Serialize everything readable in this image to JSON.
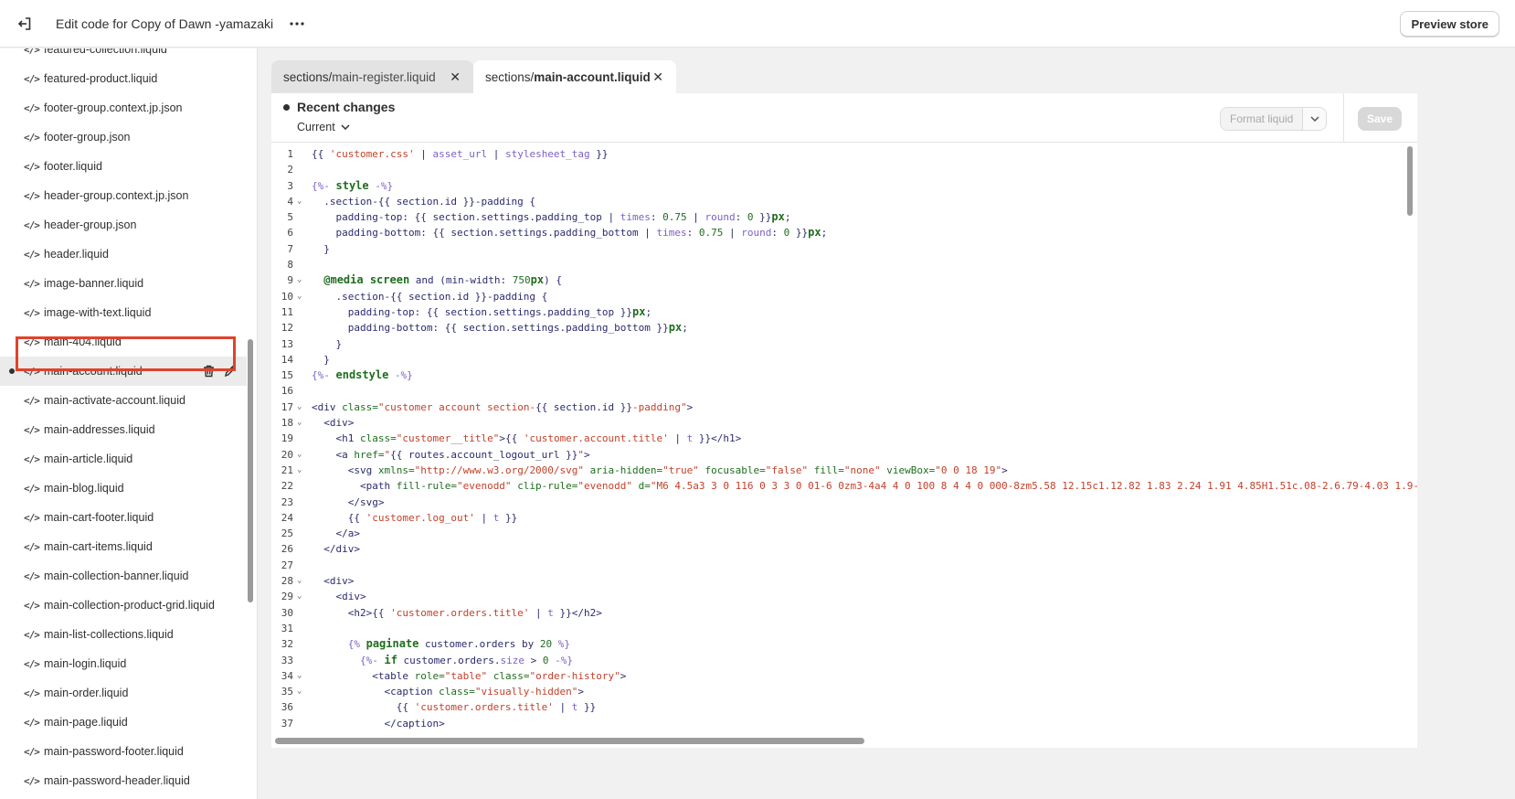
{
  "topbar": {
    "title": "Edit code for Copy of Dawn -yamazaki",
    "preview_label": "Preview store"
  },
  "sidebar": {
    "files": [
      {
        "name": "featured-collection.liquid"
      },
      {
        "name": "featured-product.liquid"
      },
      {
        "name": "footer-group.context.jp.json"
      },
      {
        "name": "footer-group.json"
      },
      {
        "name": "footer.liquid"
      },
      {
        "name": "header-group.context.jp.json"
      },
      {
        "name": "header-group.json"
      },
      {
        "name": "header.liquid"
      },
      {
        "name": "image-banner.liquid"
      },
      {
        "name": "image-with-text.liquid"
      },
      {
        "name": "main-404.liquid"
      },
      {
        "name": "main-account.liquid",
        "active": true,
        "modified": true
      },
      {
        "name": "main-activate-account.liquid"
      },
      {
        "name": "main-addresses.liquid"
      },
      {
        "name": "main-article.liquid"
      },
      {
        "name": "main-blog.liquid"
      },
      {
        "name": "main-cart-footer.liquid"
      },
      {
        "name": "main-cart-items.liquid"
      },
      {
        "name": "main-collection-banner.liquid"
      },
      {
        "name": "main-collection-product-grid.liquid"
      },
      {
        "name": "main-list-collections.liquid"
      },
      {
        "name": "main-login.liquid"
      },
      {
        "name": "main-order.liquid"
      },
      {
        "name": "main-page.liquid"
      },
      {
        "name": "main-password-footer.liquid"
      },
      {
        "name": "main-password-header.liquid"
      }
    ],
    "code_glyph": "</>"
  },
  "tabs": [
    {
      "dir": "sections/",
      "file": "main-register.liquid",
      "active": false
    },
    {
      "dir": "sections/",
      "file": "main-account.liquid",
      "active": true
    }
  ],
  "editor": {
    "recent_changes": "Recent changes",
    "version_select": "Current",
    "format_label": "Format liquid",
    "save_label": "Save",
    "lines": [
      {
        "n": "1",
        "fold": false,
        "tokens": [
          [
            "{{ ",
            "p"
          ],
          [
            "'customer.css'",
            "s"
          ],
          [
            " | ",
            "p"
          ],
          [
            "asset_url",
            "f"
          ],
          [
            " | ",
            "p"
          ],
          [
            "stylesheet_tag",
            "f"
          ],
          [
            " }}",
            "p"
          ]
        ]
      },
      {
        "n": "2",
        "fold": false,
        "tokens": []
      },
      {
        "n": "3",
        "fold": false,
        "tokens": [
          [
            "{%- ",
            "b"
          ],
          [
            "style",
            "k"
          ],
          [
            " -%}",
            "b"
          ]
        ]
      },
      {
        "n": "4",
        "fold": true,
        "tokens": [
          [
            "  .section-{{ ",
            "p"
          ],
          [
            "section.id",
            "p"
          ],
          [
            " }}-padding {",
            "p"
          ]
        ]
      },
      {
        "n": "5",
        "fold": false,
        "tokens": [
          [
            "    padding-top: {{ section.settings.padding_top | ",
            "p"
          ],
          [
            "times",
            "f"
          ],
          [
            ": ",
            "p"
          ],
          [
            "0.75",
            "n"
          ],
          [
            " | ",
            "p"
          ],
          [
            "round",
            "f"
          ],
          [
            ": ",
            "p"
          ],
          [
            "0",
            "n"
          ],
          [
            " }}",
            "p"
          ],
          [
            "px",
            "k"
          ],
          [
            ";",
            "p"
          ]
        ]
      },
      {
        "n": "6",
        "fold": false,
        "tokens": [
          [
            "    padding-bottom: {{ section.settings.padding_bottom | ",
            "p"
          ],
          [
            "times",
            "f"
          ],
          [
            ": ",
            "p"
          ],
          [
            "0.75",
            "n"
          ],
          [
            " | ",
            "p"
          ],
          [
            "round",
            "f"
          ],
          [
            ": ",
            "p"
          ],
          [
            "0",
            "n"
          ],
          [
            " }}",
            "p"
          ],
          [
            "px",
            "k"
          ],
          [
            ";",
            "p"
          ]
        ]
      },
      {
        "n": "7",
        "fold": false,
        "tokens": [
          [
            "  }",
            "p"
          ]
        ]
      },
      {
        "n": "8",
        "fold": false,
        "tokens": []
      },
      {
        "n": "9",
        "fold": true,
        "tokens": [
          [
            "  ",
            "p"
          ],
          [
            "@media screen",
            "k"
          ],
          [
            " and (min-width: ",
            "p"
          ],
          [
            "750",
            "n"
          ],
          [
            "px",
            "k"
          ],
          [
            ") {",
            "p"
          ]
        ]
      },
      {
        "n": "10",
        "fold": true,
        "tokens": [
          [
            "    .section-{{ section.id }}-padding {",
            "p"
          ]
        ]
      },
      {
        "n": "11",
        "fold": false,
        "tokens": [
          [
            "      padding-top: {{ section.settings.padding_top }}",
            "p"
          ],
          [
            "px",
            "k"
          ],
          [
            ";",
            "p"
          ]
        ]
      },
      {
        "n": "12",
        "fold": false,
        "tokens": [
          [
            "      padding-bottom: {{ section.settings.padding_bottom }}",
            "p"
          ],
          [
            "px",
            "k"
          ],
          [
            ";",
            "p"
          ]
        ]
      },
      {
        "n": "13",
        "fold": false,
        "tokens": [
          [
            "    }",
            "p"
          ]
        ]
      },
      {
        "n": "14",
        "fold": false,
        "tokens": [
          [
            "  }",
            "p"
          ]
        ]
      },
      {
        "n": "15",
        "fold": false,
        "tokens": [
          [
            "{%- ",
            "b"
          ],
          [
            "endstyle",
            "k"
          ],
          [
            " -%}",
            "b"
          ]
        ]
      },
      {
        "n": "16",
        "fold": false,
        "tokens": []
      },
      {
        "n": "17",
        "fold": true,
        "tokens": [
          [
            "<div ",
            "p"
          ],
          [
            "class=",
            "a"
          ],
          [
            "\"customer account section-",
            "s"
          ],
          [
            "{{ section.id }}",
            "p"
          ],
          [
            "-padding\"",
            "s"
          ],
          [
            ">",
            "p"
          ]
        ]
      },
      {
        "n": "18",
        "fold": true,
        "tokens": [
          [
            "  <div>",
            "p"
          ]
        ]
      },
      {
        "n": "19",
        "fold": false,
        "tokens": [
          [
            "    <h1 ",
            "p"
          ],
          [
            "class=",
            "a"
          ],
          [
            "\"customer__title\"",
            "s"
          ],
          [
            ">{{ ",
            "p"
          ],
          [
            "'customer.account.title'",
            "s"
          ],
          [
            " | ",
            "p"
          ],
          [
            "t",
            "f"
          ],
          [
            " }}</h1>",
            "p"
          ]
        ]
      },
      {
        "n": "20",
        "fold": true,
        "tokens": [
          [
            "    <a ",
            "p"
          ],
          [
            "href=",
            "a"
          ],
          [
            "\"",
            "s"
          ],
          [
            "{{ routes.account_logout_url }}",
            "p"
          ],
          [
            "\"",
            "s"
          ],
          [
            ">",
            "p"
          ]
        ]
      },
      {
        "n": "21",
        "fold": true,
        "tokens": [
          [
            "      <svg ",
            "p"
          ],
          [
            "xmlns=",
            "a"
          ],
          [
            "\"http://www.w3.org/2000/svg\"",
            "s"
          ],
          [
            " ",
            "p"
          ],
          [
            "aria-hidden=",
            "a"
          ],
          [
            "\"true\"",
            "s"
          ],
          [
            " ",
            "p"
          ],
          [
            "focusable=",
            "a"
          ],
          [
            "\"false\"",
            "s"
          ],
          [
            " ",
            "p"
          ],
          [
            "fill=",
            "a"
          ],
          [
            "\"none\"",
            "s"
          ],
          [
            " ",
            "p"
          ],
          [
            "viewBox=",
            "a"
          ],
          [
            "\"0 0 18 19\"",
            "s"
          ],
          [
            ">",
            "p"
          ]
        ]
      },
      {
        "n": "22",
        "fold": false,
        "tokens": [
          [
            "        <path ",
            "p"
          ],
          [
            "fill-rule=",
            "a"
          ],
          [
            "\"evenodd\"",
            "s"
          ],
          [
            " ",
            "p"
          ],
          [
            "clip-rule=",
            "a"
          ],
          [
            "\"evenodd\"",
            "s"
          ],
          [
            " ",
            "p"
          ],
          [
            "d=",
            "a"
          ],
          [
            "\"M6 4.5a3 3 0 116 0 3 3 0 01-6 0zm3-4a4 4 0 100 8 4 4 0 000-8zm5.58 12.15c1.12.82 1.83 2.24 1.91 4.85H1.51c.08-2.6.79-4.03 1.9-4.85C4.66 11.",
            "s"
          ]
        ]
      },
      {
        "n": "23",
        "fold": false,
        "tokens": [
          [
            "      </svg>",
            "p"
          ]
        ]
      },
      {
        "n": "24",
        "fold": false,
        "tokens": [
          [
            "      {{ ",
            "p"
          ],
          [
            "'customer.log_out'",
            "s"
          ],
          [
            " | ",
            "p"
          ],
          [
            "t",
            "f"
          ],
          [
            " }}",
            "p"
          ]
        ]
      },
      {
        "n": "25",
        "fold": false,
        "tokens": [
          [
            "    </a>",
            "p"
          ]
        ]
      },
      {
        "n": "26",
        "fold": false,
        "tokens": [
          [
            "  </div>",
            "p"
          ]
        ]
      },
      {
        "n": "27",
        "fold": false,
        "tokens": []
      },
      {
        "n": "28",
        "fold": true,
        "tokens": [
          [
            "  <div>",
            "p"
          ]
        ]
      },
      {
        "n": "29",
        "fold": true,
        "tokens": [
          [
            "    <div>",
            "p"
          ]
        ]
      },
      {
        "n": "30",
        "fold": false,
        "tokens": [
          [
            "      <h2>{{ ",
            "p"
          ],
          [
            "'customer.orders.title'",
            "s"
          ],
          [
            " | ",
            "p"
          ],
          [
            "t",
            "f"
          ],
          [
            " }}</h2>",
            "p"
          ]
        ]
      },
      {
        "n": "31",
        "fold": false,
        "tokens": []
      },
      {
        "n": "32",
        "fold": false,
        "tokens": [
          [
            "      {% ",
            "b"
          ],
          [
            "paginate",
            "k"
          ],
          [
            " customer.orders ",
            "p"
          ],
          [
            "by",
            "p"
          ],
          [
            " ",
            "p"
          ],
          [
            "20",
            "n"
          ],
          [
            " %}",
            "b"
          ]
        ]
      },
      {
        "n": "33",
        "fold": false,
        "tokens": [
          [
            "        {%- ",
            "b"
          ],
          [
            "if",
            "k"
          ],
          [
            " customer.orders.",
            "p"
          ],
          [
            "size",
            "f"
          ],
          [
            " > ",
            "p"
          ],
          [
            "0",
            "n"
          ],
          [
            " -%}",
            "b"
          ]
        ]
      },
      {
        "n": "34",
        "fold": true,
        "tokens": [
          [
            "          <table ",
            "p"
          ],
          [
            "role=",
            "a"
          ],
          [
            "\"table\"",
            "s"
          ],
          [
            " ",
            "p"
          ],
          [
            "class=",
            "a"
          ],
          [
            "\"order-history\"",
            "s"
          ],
          [
            ">",
            "p"
          ]
        ]
      },
      {
        "n": "35",
        "fold": true,
        "tokens": [
          [
            "            <caption ",
            "p"
          ],
          [
            "class=",
            "a"
          ],
          [
            "\"visually-hidden\"",
            "s"
          ],
          [
            ">",
            "p"
          ]
        ]
      },
      {
        "n": "36",
        "fold": false,
        "tokens": [
          [
            "              {{ ",
            "p"
          ],
          [
            "'customer.orders.title'",
            "s"
          ],
          [
            " | ",
            "p"
          ],
          [
            "t",
            "f"
          ],
          [
            " }}",
            "p"
          ]
        ]
      },
      {
        "n": "37",
        "fold": false,
        "tokens": [
          [
            "            </caption>",
            "p"
          ]
        ]
      }
    ]
  }
}
